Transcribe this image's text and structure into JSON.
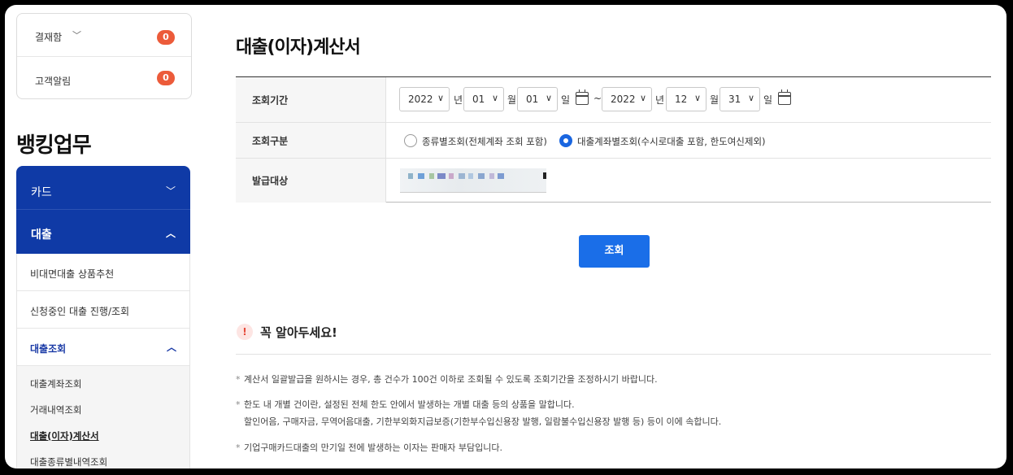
{
  "sidebar": {
    "approval_label": "결재함",
    "approval_count": "0",
    "alerts_label": "고객알림",
    "alerts_count": "0",
    "section_title": "뱅킹업무",
    "menu_card": "카드",
    "menu_loan": "대출",
    "items": [
      "비대면대출 상품추천",
      "신청중인 대출 진행/조회",
      "대출조회"
    ],
    "sub_items": [
      "대출계좌조회",
      "거래내역조회",
      "대출(이자)계산서",
      "대출종류별내역조회"
    ]
  },
  "main": {
    "title": "대출(이자)계산서",
    "period_label": "조회기간",
    "type_label": "조회구분",
    "target_label": "발급대상",
    "start_year": "2022",
    "start_month": "01",
    "start_day": "01",
    "end_year": "2022",
    "end_month": "12",
    "end_day": "31",
    "unit_year": "년",
    "unit_month": "월",
    "unit_day": "일",
    "tilde": "~",
    "radio_by_type": "종류별조회(전체계좌 조회 포함)",
    "radio_by_account": "대출계좌별조회(수시로대출 포함, 한도여신제외)",
    "search_button": "조회"
  },
  "notice": {
    "title": "꼭 알아두세요!",
    "bullet_mark": "*",
    "items": [
      "계산서 일괄발급을 원하시는 경우, 총 건수가 100건 이하로 조회될 수 있도록 조회기간을 조정하시기 바랍니다.",
      "한도 내 개별 건이란, 설정된 전체 한도 안에서 발생하는 개별 대출 등의 상품을 말합니다.",
      "할인어음, 구매자금, 무역어음대출, 기한부외화지급보증(기한부수입신용장 발행, 일람불수입신용장 발행 등) 등이 이에 속합니다.",
      "기업구매카드대출의 만기일 전에 발생하는 이자는 판매자 부담입니다."
    ]
  },
  "colors": {
    "brand_blue": "#0f3aa6",
    "button_blue": "#1a6ee8",
    "badge": "#ec5b3a"
  }
}
